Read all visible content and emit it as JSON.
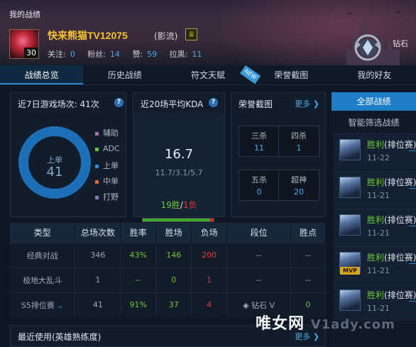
{
  "window": {
    "title": "我的战绩"
  },
  "profile": {
    "level": "30",
    "name": "快来熊猫TV12075",
    "tag": "(影流)",
    "stats": [
      {
        "label": "关注:",
        "value": "0"
      },
      {
        "label": "粉丝:",
        "value": "14"
      },
      {
        "label": "赞:",
        "value": "59"
      },
      {
        "label": "拉黑:",
        "value": "11"
      }
    ],
    "rank": "钻石"
  },
  "tabs": [
    {
      "label": "战绩总览",
      "active": true
    },
    {
      "label": "历史战绩",
      "active": false
    },
    {
      "label": "符文天赋",
      "active": false
    },
    {
      "label": "荣誉截图",
      "active": false
    },
    {
      "label": "我的好友",
      "active": false
    }
  ],
  "new_badge": "NEW",
  "recent_games": {
    "title": "近7日游戏场次: 41次",
    "center_label": "上单",
    "center_value": "41",
    "legend": [
      {
        "label": "辅助",
        "color": "#b06ab0"
      },
      {
        "label": "ADC",
        "color": "#6cbf3a"
      },
      {
        "label": "上单",
        "color": "#2e8fd6"
      },
      {
        "label": "中单",
        "color": "#e0673a"
      },
      {
        "label": "打野",
        "color": "#8a7ab8"
      }
    ],
    "donut_color": "#1d6fb8"
  },
  "kda": {
    "title": "近20场平均KDA",
    "value": "16.7",
    "detail": "11.7/3.1/5.7",
    "wins": "19",
    "win_label": "胜",
    "losses": "1",
    "loss_label": "负",
    "win_ratio": 0.95
  },
  "honor": {
    "title": "荣誉截图",
    "more": "更多",
    "cells": [
      {
        "label": "三杀",
        "value": "11"
      },
      {
        "label": "四杀",
        "value": "1"
      },
      {
        "label": "五杀",
        "value": "0"
      },
      {
        "label": "超神",
        "value": "20"
      }
    ]
  },
  "table": {
    "headers": [
      "类型",
      "总场次数",
      "胜率",
      "胜场",
      "负场",
      "段位",
      "胜点"
    ],
    "rows": [
      {
        "type": "经典对战",
        "total": "346",
        "rate": "43%",
        "wins": "146",
        "losses": "200",
        "rank": "--",
        "points": "--"
      },
      {
        "type": "极地大乱斗",
        "total": "1",
        "rate": "--",
        "wins": "0",
        "losses": "1",
        "rank": "--",
        "points": "--"
      },
      {
        "type": "S5排位赛",
        "total": "41",
        "rate": "91%",
        "wins": "37",
        "losses": "4",
        "rank": "钻石 V",
        "points": "0"
      }
    ]
  },
  "hero_usage": {
    "title": "最近使用(英雄熟练度)",
    "more": "更多"
  },
  "right_panel": {
    "tab": "全部战绩",
    "filter": "智能筛选战绩",
    "matches": [
      {
        "result": "胜利",
        "mode": "(排位赛)",
        "date": "11-22",
        "mvp": false
      },
      {
        "result": "胜利",
        "mode": "(排位赛)",
        "date": "11-21",
        "mvp": false
      },
      {
        "result": "胜利",
        "mode": "(排位赛)",
        "date": "11-21",
        "mvp": false
      },
      {
        "result": "胜利",
        "mode": "(排位赛)",
        "date": "11-21",
        "mvp": true
      },
      {
        "result": "胜利",
        "mode": "(排位赛)",
        "date": "11-21",
        "mvp": false
      }
    ],
    "mvp_label": "MVP"
  },
  "watermark": {
    "text": "唯女网",
    "sub": "V1ady.com"
  }
}
